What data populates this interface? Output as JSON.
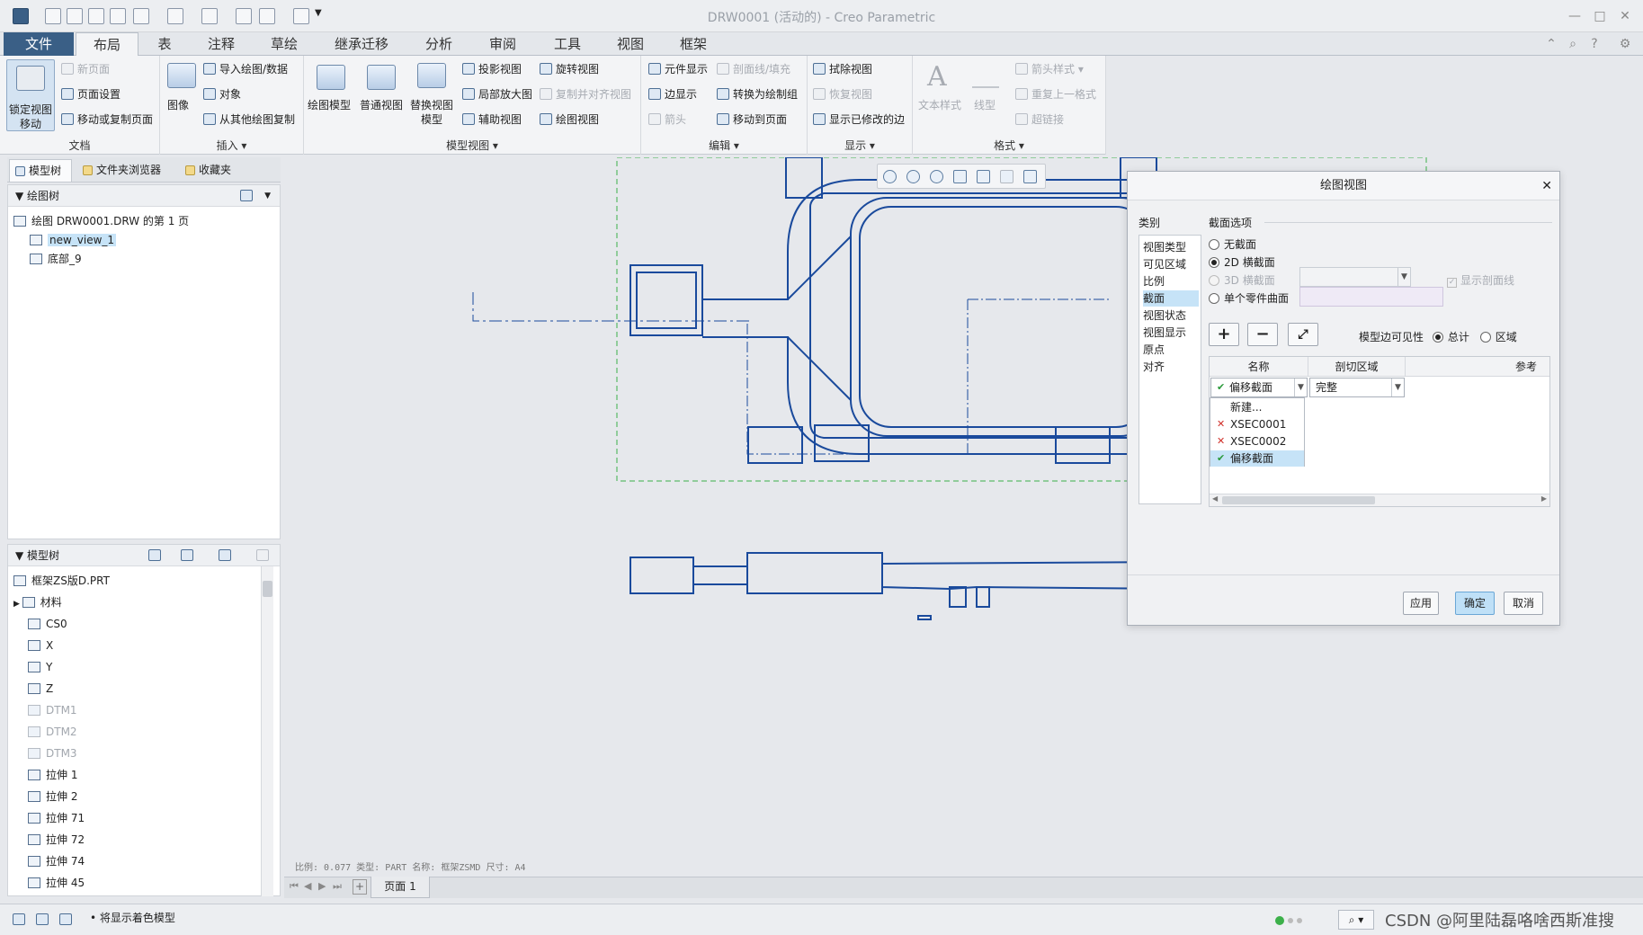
{
  "window": {
    "title": "DRW0001 (活动的) - Creo Parametric"
  },
  "tabs": [
    "文件",
    "布局",
    "表",
    "注释",
    "草绘",
    "继承迁移",
    "分析",
    "审阅",
    "工具",
    "视图",
    "框架"
  ],
  "active_tab": "布局",
  "ribbon": {
    "doc": {
      "label": "文档",
      "lock_view": "锁定视图",
      "lock_view2": "移动",
      "new_page": "新页面",
      "page_setup": "页面设置",
      "move_copy_page": "移动或复制页面"
    },
    "insert": {
      "label": "插入",
      "image": "图像",
      "import_drawing": "导入绘图/数据",
      "object": "对象",
      "copy_from": "从其他绘图复制"
    },
    "model_views": {
      "label": "模型视图",
      "drawing_model": "绘图模型",
      "general_view": "普通视图",
      "replace_view": "替换视图",
      "replace_view2": "模型",
      "projection": "投影视图",
      "detailed": "局部放大图",
      "auxiliary": "辅助视图",
      "revolved": "旋转视图",
      "copy_align": "复制并对齐视图",
      "drawing_view": "绘图视图"
    },
    "edit": {
      "label": "编辑",
      "element_display": "元件显示",
      "edge_display": "边显示",
      "arrow": "箭头",
      "section_fill": "剖面线/填充",
      "convert_group": "转换为绘制组",
      "move_to_page": "移动到页面"
    },
    "display": {
      "label": "显示",
      "erase_view": "拭除视图",
      "resume_view": "恢复视图",
      "show_modified": "显示已修改的边"
    },
    "format": {
      "label": "格式",
      "text_style": "文本样式",
      "line_style": "线型",
      "arrow_style": "箭头样式",
      "repeat_last": "重复上一格式",
      "hyperlink": "超链接"
    }
  },
  "left_tabs": [
    "模型树",
    "文件夹浏览器",
    "收藏夹"
  ],
  "drawing_tree": {
    "header": "绘图树",
    "root": "绘图 DRW0001.DRW 的第 1 页",
    "items": [
      "new_view_1",
      "底部_9"
    ]
  },
  "model_tree": {
    "header": "模型树",
    "root": "框架ZS版D.PRT",
    "items": [
      {
        "label": "材料",
        "dim": false
      },
      {
        "label": "CS0",
        "dim": false
      },
      {
        "label": "X",
        "dim": false
      },
      {
        "label": "Y",
        "dim": false
      },
      {
        "label": "Z",
        "dim": false
      },
      {
        "label": "DTM1",
        "dim": true
      },
      {
        "label": "DTM2",
        "dim": true
      },
      {
        "label": "DTM3",
        "dim": true
      },
      {
        "label": "拉伸 1",
        "dim": false
      },
      {
        "label": "拉伸 2",
        "dim": false
      },
      {
        "label": "拉伸 71",
        "dim": false
      },
      {
        "label": "拉伸 72",
        "dim": false
      },
      {
        "label": "拉伸 74",
        "dim": false
      },
      {
        "label": "拉伸 45",
        "dim": false
      }
    ]
  },
  "canvas": {
    "info": "比例: 0.077   类型: PART   名称: 框架ZSMD   尺寸: A4",
    "page_tab": "页面 1"
  },
  "status": {
    "message": "将显示着色模型",
    "watermark": "CSDN @阿里陆磊咯啥西斯准搜"
  },
  "dialog": {
    "title": "绘图视图",
    "category_label": "类别",
    "categories": [
      "视图类型",
      "可见区域",
      "比例",
      "截面",
      "视图状态",
      "视图显示",
      "原点",
      "对齐"
    ],
    "selected_category": "截面",
    "section_options_label": "截面选项",
    "options": {
      "none": "无截面",
      "xsec2d": "2D 横截面",
      "xsec3d": "3D 横截面",
      "single_surface": "单个零件曲面",
      "show_xhatch": "显示剖面线"
    },
    "model_edge_visibility": "模型边可见性",
    "visibility_total": "总计",
    "visibility_area": "区域",
    "table_headers": [
      "名称",
      "剖切区域",
      "参考"
    ],
    "selected_section": "偏移截面",
    "cut_area": "完整",
    "dropdown_items": [
      {
        "mark": "",
        "label": "新建..."
      },
      {
        "mark": "x",
        "label": "XSEC0001"
      },
      {
        "mark": "x",
        "label": "XSEC0002"
      },
      {
        "mark": "check",
        "label": "偏移截面"
      }
    ],
    "buttons": {
      "apply": "应用",
      "ok": "确定",
      "cancel": "取消"
    }
  },
  "colors": {
    "accent": "#3a5f86",
    "drawing_line": "#1a4a9c",
    "selection": "#c6e3f7",
    "border_green": "#3cb04a"
  }
}
